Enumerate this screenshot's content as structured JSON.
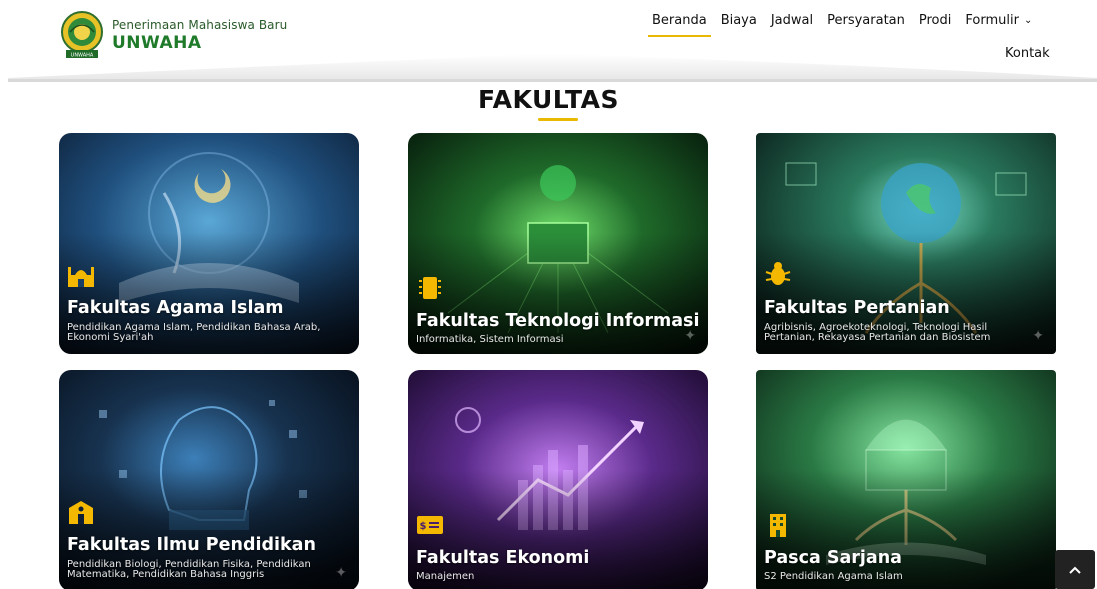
{
  "brand": {
    "subtitle": "Penerimaan Mahasiswa Baru",
    "name": "UNWAHA",
    "logo_band_text": "UNWAHA"
  },
  "nav": {
    "items": [
      {
        "label": "Beranda",
        "active": true
      },
      {
        "label": "Biaya"
      },
      {
        "label": "Jadwal"
      },
      {
        "label": "Persyaratan"
      },
      {
        "label": "Prodi"
      },
      {
        "label": "Formulir"
      }
    ],
    "contact": "Kontak"
  },
  "section": {
    "title": "FAKULTAS"
  },
  "cards": [
    {
      "title": "Fakultas Agama Islam",
      "desc": "Pendidikan Agama Islam, Pendidikan Bahasa Arab, Ekonomi Syari'ah",
      "icon": "mosque-icon",
      "theme": "#1a3f66"
    },
    {
      "title": "Fakultas Teknologi Informasi",
      "desc": "Informatika, Sistem Informasi",
      "icon": "chip-icon",
      "theme": "#123a1d"
    },
    {
      "title": "Fakultas Pertanian",
      "desc": "Agribisnis, Agroekoteknologi, Teknologi Hasil Pertanian, Rekayasa Pertanian dan Biosistem",
      "icon": "bug-icon",
      "theme": "#15402e"
    },
    {
      "title": "Fakultas Ilmu Pendidikan",
      "desc": "Pendidikan Biologi, Pendidikan Fisika, Pendidikan Matematika, Pendidikan Bahasa Inggris",
      "icon": "school-icon",
      "theme": "#0f1e33"
    },
    {
      "title": "Fakultas Ekonomi",
      "desc": "Manajemen",
      "icon": "money-icon",
      "theme": "#4a1f6e"
    },
    {
      "title": "Pasca Sarjana",
      "desc": "S2 Pendidikan Agama Islam",
      "icon": "building-icon",
      "theme": "#174a2b"
    }
  ],
  "colors": {
    "accent": "#e9b800",
    "brand_green": "#1f7a2a",
    "icon_yellow": "#f5b800"
  }
}
